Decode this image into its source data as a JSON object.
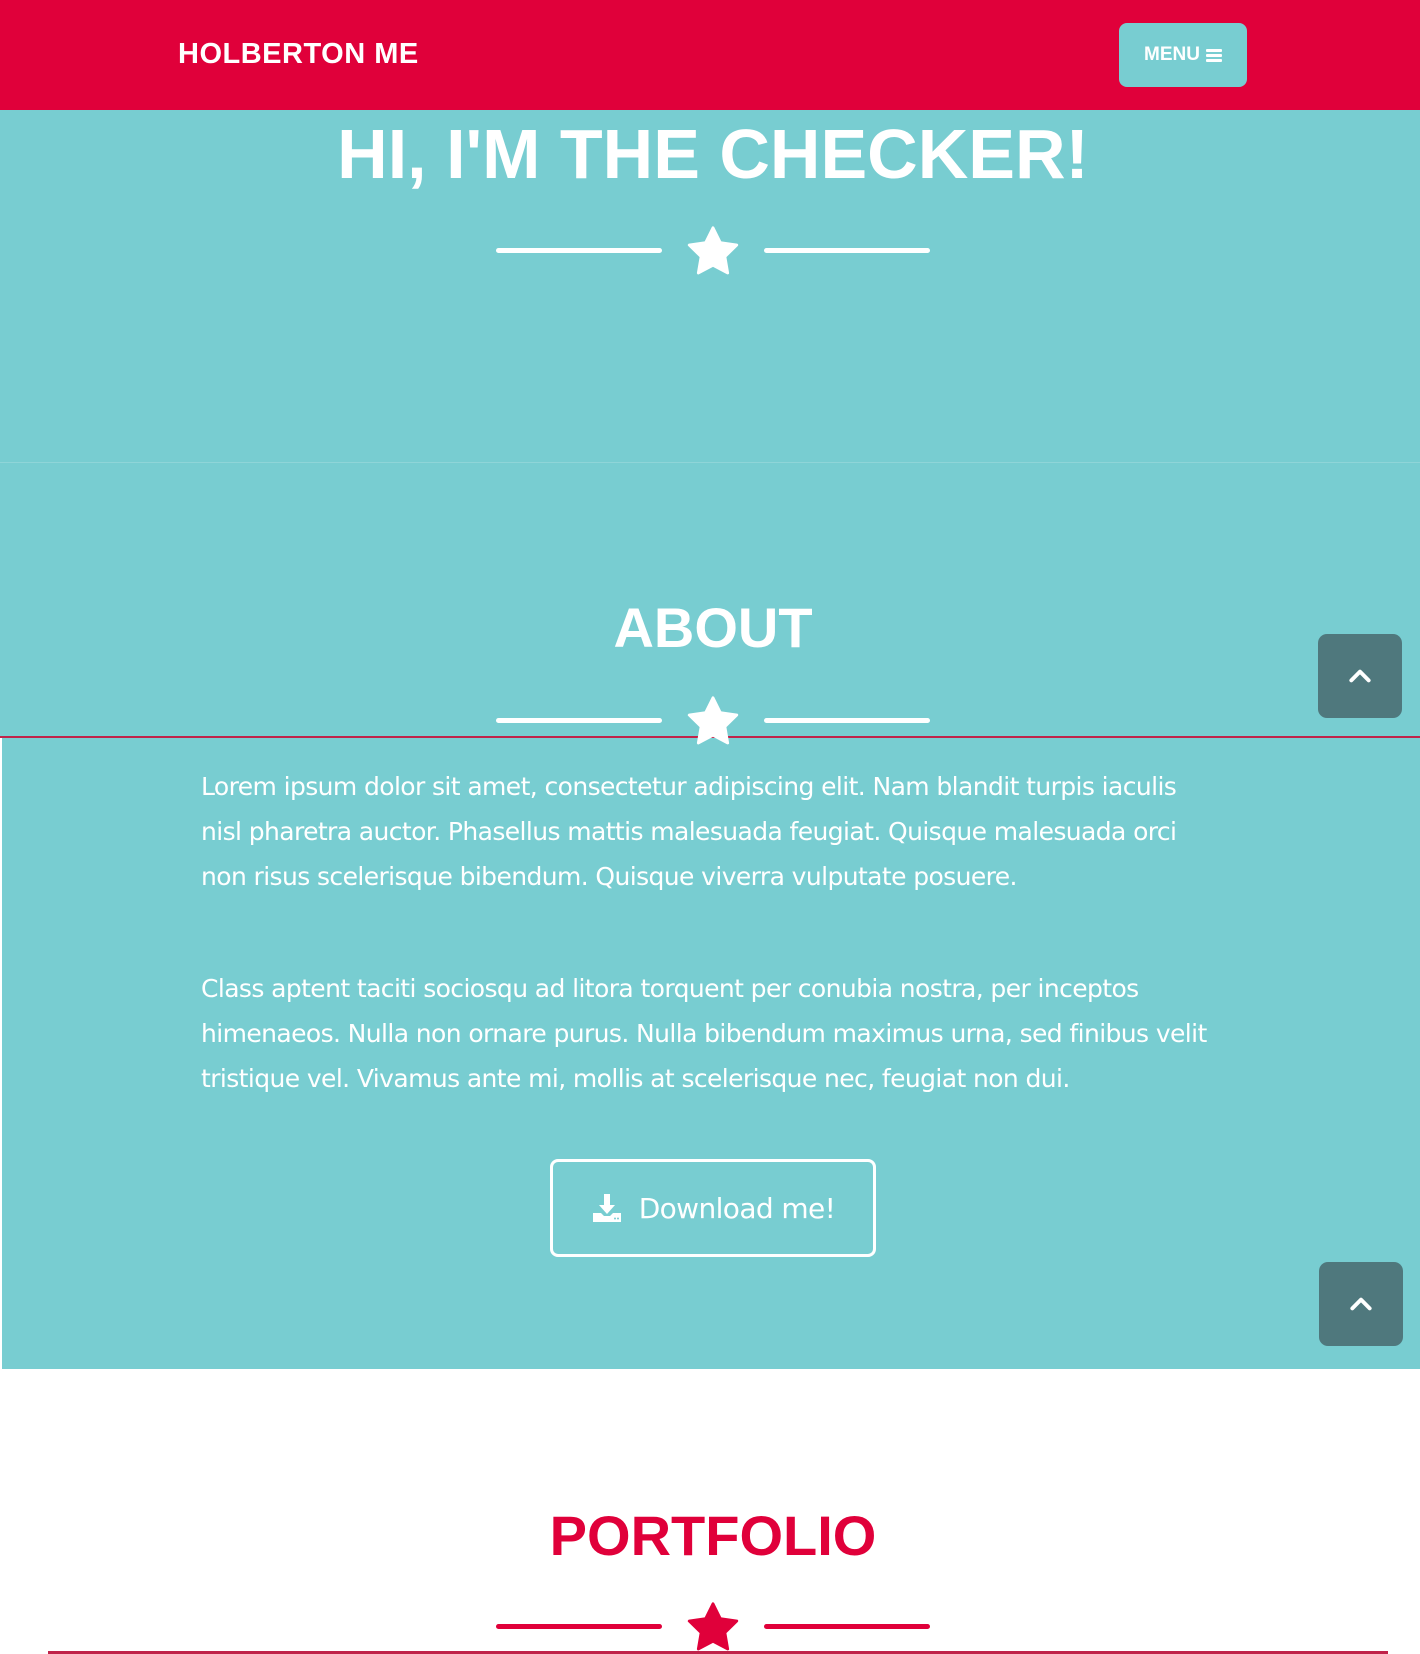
{
  "navbar": {
    "brand": "HOLBERTON ME",
    "menu_label": "MENU",
    "menu_icon": "hamburger-icon"
  },
  "masthead": {
    "title": "HI, I'M THE CHECKER!",
    "divider_icon": "star-icon"
  },
  "about": {
    "title": "ABOUT",
    "divider_icon": "star-icon",
    "paragraphs": [
      "Lorem ipsum dolor sit amet, consectetur adipiscing elit. Nam blandit turpis iaculis nisl pharetra auctor. Phasellus mattis malesuada feugiat. Quisque malesuada orci non risus scelerisque bibendum. Quisque viverra vulputate posuere.",
      "Class aptent taciti sociosqu ad litora torquent per conubia nostra, per inceptos himenaeos. Nulla non ornare purus. Nulla bibendum maximus urna, sed finibus velit tristique vel. Vivamus ante mi, mollis at scelerisque nec, feugiat non dui."
    ],
    "download_label": "Download me!",
    "download_icon": "download-icon"
  },
  "scroll_top": {
    "icon": "chevron-up-icon"
  },
  "portfolio": {
    "title": "PORTFOLIO",
    "divider_icon": "star-icon"
  },
  "colors": {
    "primary": "#e0003a",
    "teal": "#78cdd1",
    "scroll_button": "#4f787d",
    "white": "#ffffff"
  }
}
